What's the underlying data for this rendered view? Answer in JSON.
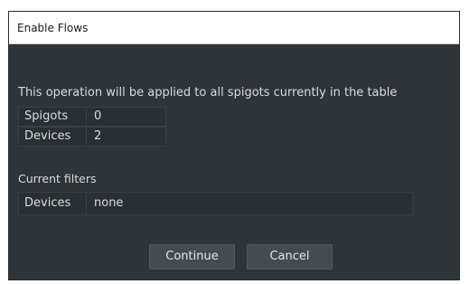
{
  "window": {
    "title": "Enable Flows"
  },
  "dialog": {
    "description": "This operation will be applied to all spigots currently in the table",
    "summary": [
      {
        "label": "Spigots",
        "value": "0"
      },
      {
        "label": "Devices",
        "value": "2"
      }
    ],
    "filters_heading": "Current filters",
    "filters": [
      {
        "label": "Devices",
        "value": "none"
      }
    ],
    "buttons": {
      "continue_label": "Continue",
      "cancel_label": "Cancel"
    }
  }
}
